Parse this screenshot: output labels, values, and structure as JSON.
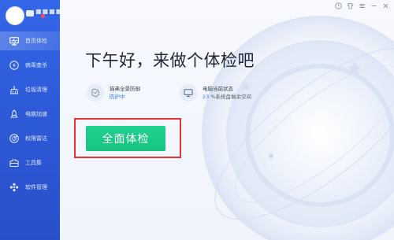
{
  "user": {
    "name": "■■■■"
  },
  "sidebar": {
    "items": [
      {
        "label": "首页体检",
        "icon": "monitor-icon",
        "active": true
      },
      {
        "label": "病毒查杀",
        "icon": "lightning-icon",
        "active": false
      },
      {
        "label": "垃圾清理",
        "icon": "broom-icon",
        "active": false
      },
      {
        "label": "电脑加速",
        "icon": "rocket-icon",
        "active": false
      },
      {
        "label": "权限雷达",
        "icon": "radar-icon",
        "active": false
      },
      {
        "label": "工具集",
        "icon": "toolbox-icon",
        "active": false
      },
      {
        "label": "软件管理",
        "icon": "apps-icon",
        "active": false
      }
    ]
  },
  "header": {
    "icons": [
      "warning-icon",
      "shirt-icon",
      "menu-icon",
      "minimize-icon",
      "close-icon"
    ]
  },
  "main": {
    "headline": "下午好，来做个体检吧",
    "protection": {
      "title": "猫弗全景防御",
      "status": "防护中",
      "icon": "shield-icon"
    },
    "pc_status": {
      "title": "电脑当前状态",
      "value": "23",
      "suffix": "%系统盘剩余空间",
      "icon": "monitor-icon"
    },
    "scan_button_label": "全面体检"
  },
  "colors": {
    "sidebar": "#2f5fe0",
    "accent_blue": "#2e7cf6",
    "scan_green": "#1fd28f",
    "highlight_red": "#e63333"
  }
}
